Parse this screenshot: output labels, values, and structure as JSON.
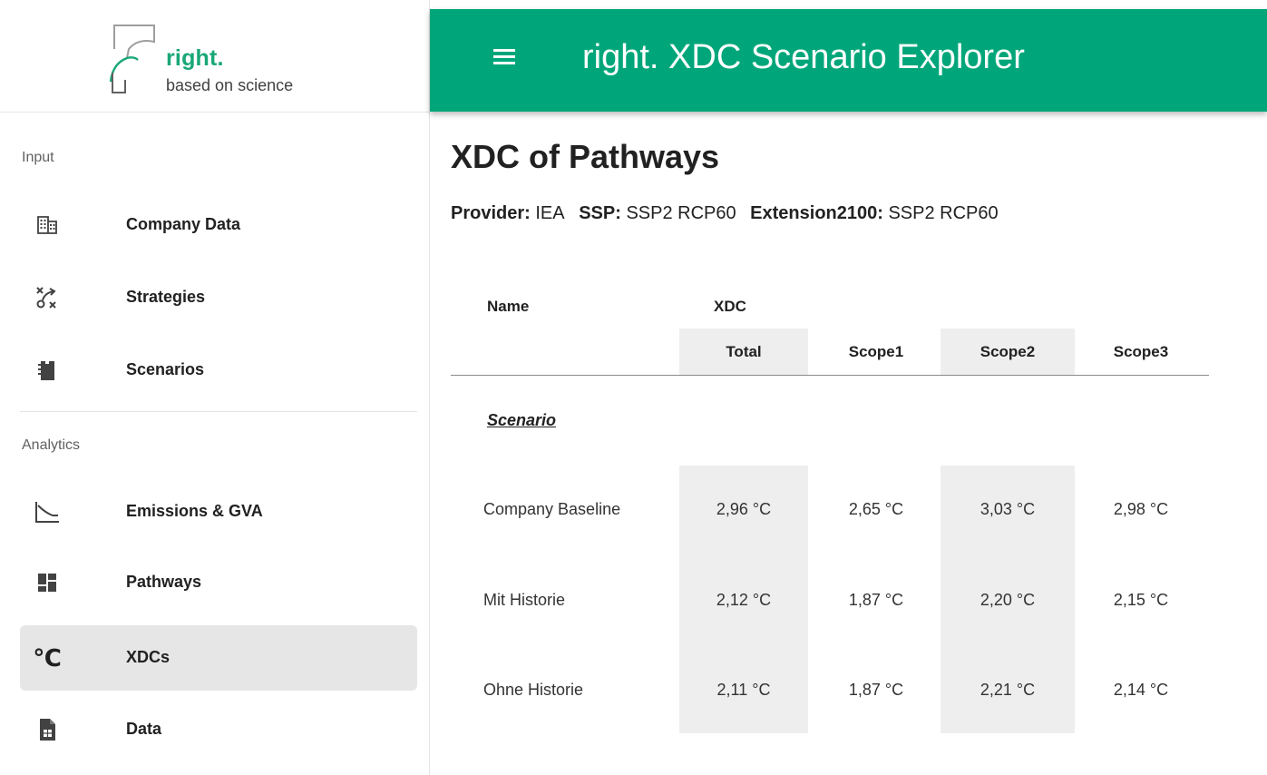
{
  "logo": {
    "name": "right.",
    "tagline": "based on science"
  },
  "appbar": {
    "title": "right. XDC Scenario Explorer",
    "menu_icon": "menu-icon",
    "color": "#00a67a"
  },
  "sidebar": {
    "sections": [
      {
        "label": "Input",
        "items": [
          {
            "label": "Company Data",
            "icon": "building-icon"
          },
          {
            "label": "Strategies",
            "icon": "strategy-icon"
          },
          {
            "label": "Scenarios",
            "icon": "scenarios-icon"
          }
        ]
      },
      {
        "label": "Analytics",
        "items": [
          {
            "label": "Emissions & GVA",
            "icon": "chart-decline-icon"
          },
          {
            "label": "Pathways",
            "icon": "dashboard-icon"
          },
          {
            "label": "XDCs",
            "icon": "celsius-icon",
            "active": true
          },
          {
            "label": "Data",
            "icon": "document-icon"
          }
        ]
      }
    ]
  },
  "main": {
    "title": "XDC of Pathways",
    "meta": {
      "provider_label": "Provider:",
      "provider_value": "IEA",
      "ssp_label": "SSP:",
      "ssp_value": "SSP2 RCP60",
      "ext_label": "Extension2100:",
      "ext_value": "SSP2 RCP60"
    },
    "table": {
      "name_header": "Name",
      "group_header": "XDC",
      "columns": [
        "Total",
        "Scope1",
        "Scope2",
        "Scope3"
      ],
      "group_label": "Scenario",
      "rows": [
        {
          "name": "Company Baseline",
          "values": [
            "2,96 °C",
            "2,65 °C",
            "3,03 °C",
            "2,98 °C"
          ]
        },
        {
          "name": "Mit Historie",
          "values": [
            "2,12 °C",
            "1,87 °C",
            "2,20 °C",
            "2,15 °C"
          ]
        },
        {
          "name": "Ohne Historie",
          "values": [
            "2,11 °C",
            "1,87 °C",
            "2,21 °C",
            "2,14 °C"
          ]
        }
      ]
    }
  }
}
